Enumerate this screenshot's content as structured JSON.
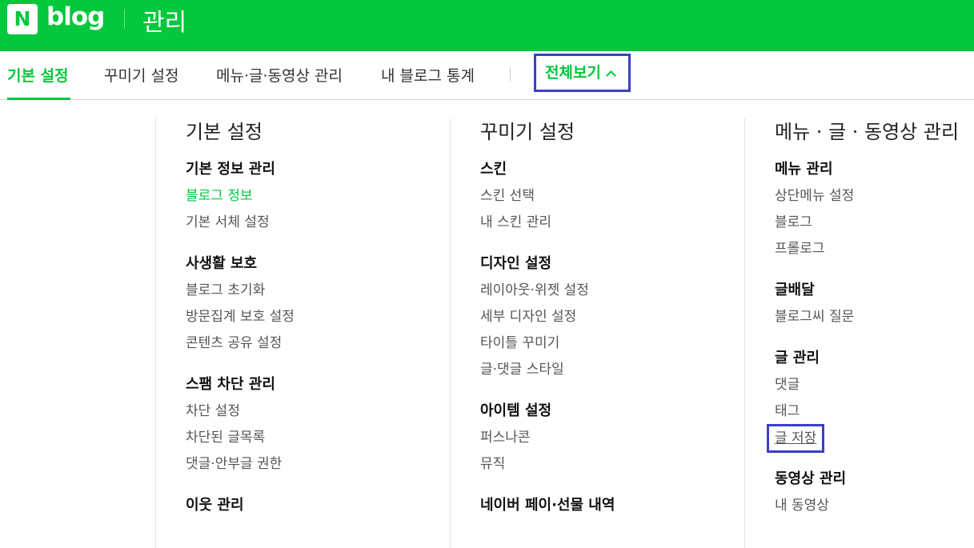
{
  "header": {
    "logo_letter": "N",
    "logo_word": "blog",
    "title": "관리"
  },
  "tabs": [
    {
      "label": "기본 설정",
      "active": true
    },
    {
      "label": "꾸미기 설정"
    },
    {
      "label": "메뉴·글·동영상 관리"
    },
    {
      "label": "내 블로그 통계"
    },
    {
      "label": "전체보기"
    }
  ],
  "menu": {
    "basic": {
      "title": "기본 설정",
      "sections": [
        {
          "head": "기본 정보 관리",
          "items": [
            "블로그 정보",
            "기본 서체 설정"
          ]
        },
        {
          "head": "사생활 보호",
          "items": [
            "블로그 초기화",
            "방문집계 보호 설정",
            "콘텐츠 공유 설정"
          ]
        },
        {
          "head": "스팸 차단 관리",
          "items": [
            "차단 설정",
            "차단된 글목록",
            "댓글·안부글 권한"
          ]
        },
        {
          "head": "이웃 관리",
          "items": []
        }
      ]
    },
    "decorate": {
      "title": "꾸미기 설정",
      "sections": [
        {
          "head": "스킨",
          "items": [
            "스킨 선택",
            "내 스킨 관리"
          ]
        },
        {
          "head": "디자인 설정",
          "items": [
            "레이아웃·위젯 설정",
            "세부 디자인 설정",
            "타이틀 꾸미기",
            "글·댓글 스타일"
          ]
        },
        {
          "head": "아이템 설정",
          "items": [
            "퍼스나콘",
            "뮤직"
          ]
        },
        {
          "head": "네이버 페이·선물 내역",
          "items": []
        }
      ]
    },
    "manage": {
      "title": "메뉴 · 글 · 동영상 관리",
      "sections": [
        {
          "head": "메뉴 관리",
          "items": [
            "상단메뉴 설정",
            "블로그",
            "프롤로그"
          ]
        },
        {
          "head": "글배달",
          "items": [
            "블로그씨 질문"
          ]
        },
        {
          "head": "글 관리",
          "items": [
            "댓글",
            "태그",
            "글 저장"
          ]
        },
        {
          "head": "동영상 관리",
          "items": [
            "내 동영상"
          ]
        }
      ]
    }
  },
  "colors": {
    "brand_green": "#03c73c",
    "highlight_box": "#3a3fc8"
  }
}
